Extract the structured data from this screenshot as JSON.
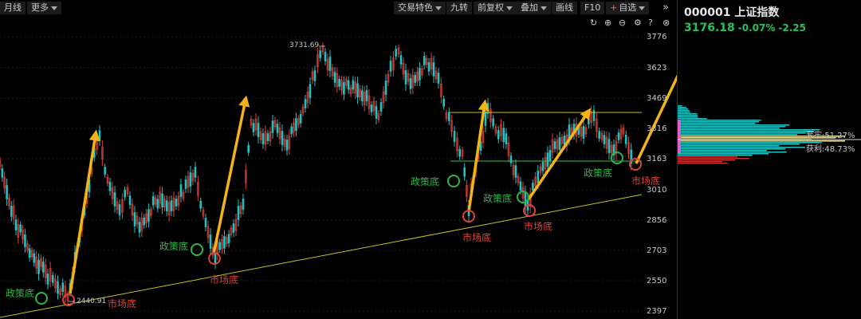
{
  "toolbar": {
    "items": [
      {
        "label": "月线",
        "arrow": false
      },
      {
        "label": "更多",
        "arrow": true
      },
      {
        "label": "交易特色",
        "arrow": true
      },
      {
        "label": "九转",
        "arrow": false
      },
      {
        "label": "前复权",
        "arrow": true
      },
      {
        "label": "叠加",
        "arrow": true
      },
      {
        "label": "画线",
        "arrow": false
      },
      {
        "label": "F10",
        "arrow": false
      },
      {
        "label": "自选",
        "arrow": true
      }
    ],
    "expand": "»"
  },
  "stock": {
    "code_name": "000001 上证指数",
    "price": "3176.18",
    "change_pct": "-0.07%",
    "change": "-2.25"
  },
  "axis_labels": [
    "3776",
    "3623",
    "3469",
    "3316",
    "3163",
    "3010",
    "2856",
    "2703",
    "2550",
    "2397"
  ],
  "chart_marks": {
    "high_label": "3731.69",
    "low_label": "2440.91"
  },
  "annotations": {
    "policy_bottom": "政策底",
    "market_bottom": "市场底"
  },
  "profile": {
    "profit_label": "套牢:51.27%",
    "win_label": "获利:48.73%"
  },
  "colors": {
    "up": "#e0403a",
    "down": "#1fc4c4",
    "arrow": "#f2b418",
    "trend": "#c8c020",
    "green": "#2fb64a"
  }
}
